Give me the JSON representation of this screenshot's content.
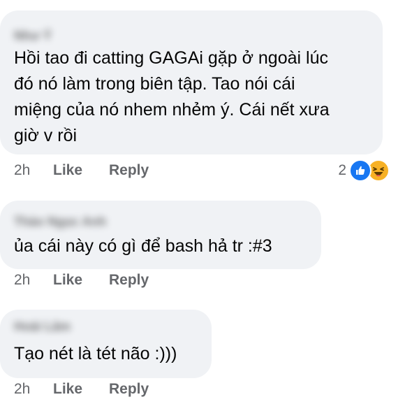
{
  "comments": [
    {
      "author": "Như Ý",
      "text": "Hồi tao đi catting GAGAi gặp ở ngoài lúc\nđó nó làm trong biên tập. Tao nói cái\nmiệng của nó nhem nhẻm ý. Cái nết xưa\ngiờ v rồi",
      "time": "2h",
      "like_label": "Like",
      "reply_label": "Reply",
      "reaction_count": "2",
      "reactions": [
        "like-icon",
        "haha-icon"
      ]
    },
    {
      "author": "Thảo Ngọc Anh",
      "text": "ủa cái này có gì để bash hả tr :#3",
      "time": "2h",
      "like_label": "Like",
      "reply_label": "Reply"
    },
    {
      "author": "Hoài Lâm",
      "text": "Tạo nét là tét não :)))",
      "time": "2h",
      "like_label": "Like",
      "reply_label": "Reply"
    }
  ],
  "colors": {
    "bubble": "#f0f2f5",
    "text": "#050505",
    "secondary": "#65676b",
    "like": "#1877f2",
    "haha": "#f7b125"
  }
}
